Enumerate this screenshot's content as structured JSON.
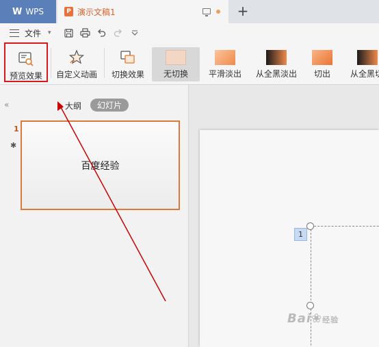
{
  "titlebar": {
    "app_name": "WPS",
    "document_title": "演示文稿1"
  },
  "menubar": {
    "file_label": "文件"
  },
  "ribbon": {
    "preview_label": "预览效果",
    "custom_animation_label": "自定义动画",
    "switch_effect_label": "切换效果",
    "transitions": [
      {
        "label": "无切换"
      },
      {
        "label": "平滑淡出"
      },
      {
        "label": "从全黑淡出"
      },
      {
        "label": "切出"
      },
      {
        "label": "从全黑切"
      }
    ]
  },
  "leftpanel": {
    "tab_outline": "大纲",
    "tab_slides": "幻灯片",
    "slide_number": "1",
    "slide_text": "百度经验"
  },
  "canvas": {
    "box_number": "1"
  },
  "watermark": {
    "text": "Bai",
    "text2": "经验"
  },
  "colors": {
    "accent": "#d9622b",
    "highlight_box": "#d9181e",
    "arrow": "#cc0000"
  }
}
